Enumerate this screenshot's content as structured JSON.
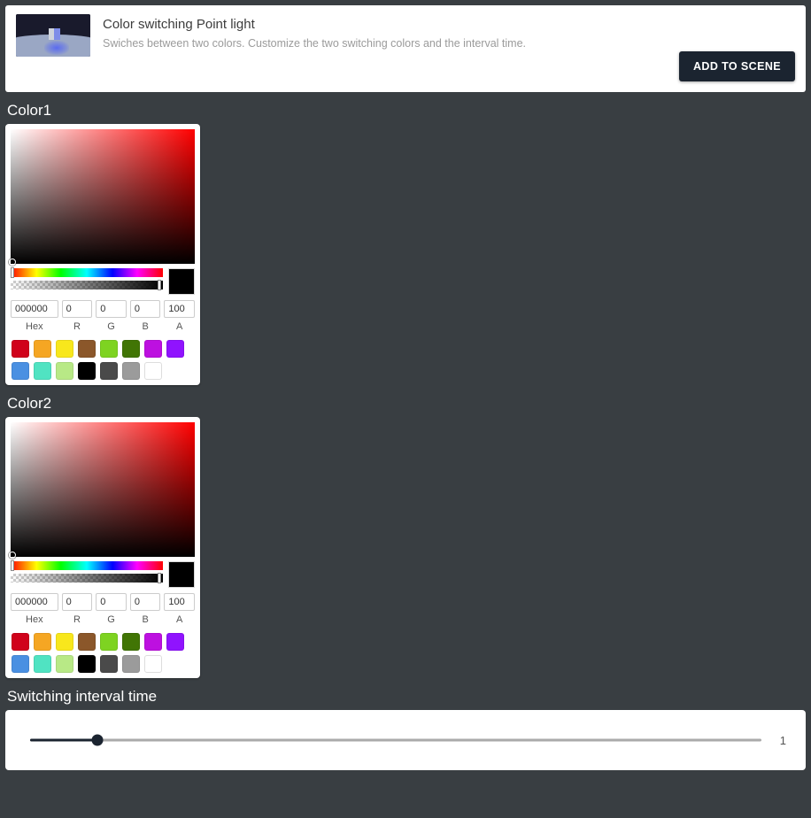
{
  "header": {
    "title": "Color switching Point light",
    "description": "Swiches between two colors. Customize the two switching colors and the interval time.",
    "add_button_label": "ADD TO SCENE",
    "thumbnail_alt": "point-light-preview"
  },
  "sections": {
    "color1_label": "Color1",
    "color2_label": "Color2",
    "interval_label": "Switching interval time"
  },
  "color_picker": {
    "hex": "000000",
    "r": "0",
    "g": "0",
    "b": "0",
    "a": "100",
    "labels": {
      "hex": "Hex",
      "r": "R",
      "g": "G",
      "b": "B",
      "a": "A"
    },
    "preview_color": "#000000",
    "hue_position_pct": 0,
    "alpha_position_pct": 100,
    "presets": [
      "#D0021B",
      "#F5A623",
      "#F8E71C",
      "#8B572A",
      "#7ED321",
      "#417505",
      "#BD10E0",
      "#9013FE",
      "#4A90E2",
      "#50E3C2",
      "#B8E986",
      "#000000",
      "#4A4A4A",
      "#9B9B9B",
      "#FFFFFF"
    ]
  },
  "interval_slider": {
    "value": "1",
    "fill_pct": 9.2,
    "min": "0",
    "max": "10"
  },
  "theme": {
    "background": "#393e42",
    "card_background": "#ffffff",
    "accent_dark": "#1b2430",
    "label_color": "#ffffff"
  }
}
